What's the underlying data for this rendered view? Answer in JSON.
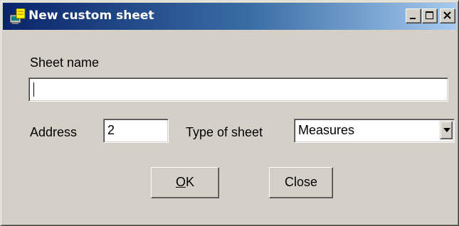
{
  "window": {
    "title": "New custom sheet",
    "icon": "app-window-icon",
    "controls": [
      "minimize-icon",
      "maximize-icon",
      "close-icon"
    ]
  },
  "form": {
    "sheet_name_label": "Sheet name",
    "sheet_name_value": "",
    "address_label": "Address",
    "address_value": "2",
    "type_label": "Type of sheet",
    "type_selected": "Measures"
  },
  "buttons": {
    "ok_mnemonic": "O",
    "ok_rest": "K",
    "close_label": "Close"
  },
  "colors": {
    "title_gradient_start": "#0a246a",
    "title_gradient_end": "#a6caf0",
    "face": "#d4d0c8"
  }
}
